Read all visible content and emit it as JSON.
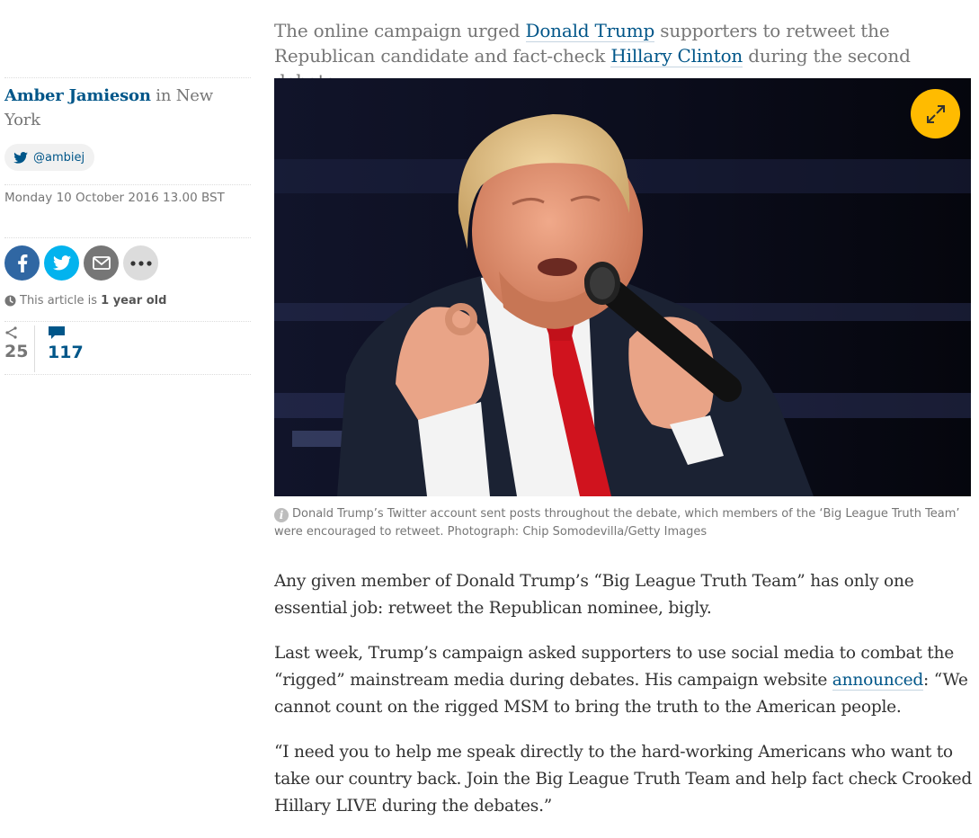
{
  "standfirst": {
    "part1": "The online campaign urged ",
    "link1": "Donald Trump",
    "part2": " supporters to retweet the Republican candidate and fact-check ",
    "link2": "Hillary Clinton",
    "part3": " during the second debate"
  },
  "byline": {
    "author": "Amber Jamieson",
    "location": " in New York",
    "twitter_handle": "@ambiej"
  },
  "dateline": "Monday 10 October 2016 13.00 BST",
  "share": {
    "icons": [
      "facebook-icon",
      "twitter-icon",
      "email-icon",
      "more-icon"
    ]
  },
  "age_notice": {
    "prefix": "This article is ",
    "age": "1 year old"
  },
  "counts": {
    "shares": "25",
    "comments": "117"
  },
  "caption": {
    "text": "Donald Trump’s Twitter account sent posts throughout the debate, which members of the ‘Big League Truth Team’ were encouraged to retweet. Photograph: Chip Somodevilla/Getty Images"
  },
  "body": {
    "p1": "Any given member of Donald Trump’s “Big League Truth Team” has only one essential job: retweet the Republican nominee, bigly.",
    "p2_part1": "Last week, Trump’s campaign asked supporters to use social media to combat the “rigged” mainstream media during debates. His campaign website ",
    "p2_link": "announced",
    "p2_part2": ": “We cannot count on the rigged MSM to bring the truth to the American people.",
    "p3": "“I need you to help me speak directly to the hard-working Americans who want to take our country back. Join the Big League Truth Team and help fact check Crooked Hillary LIVE during the debates.”"
  },
  "colors": {
    "link": "#005689",
    "facebook": "#3067a3",
    "twitter": "#03b3ee",
    "expand_button": "#ffbb00"
  }
}
